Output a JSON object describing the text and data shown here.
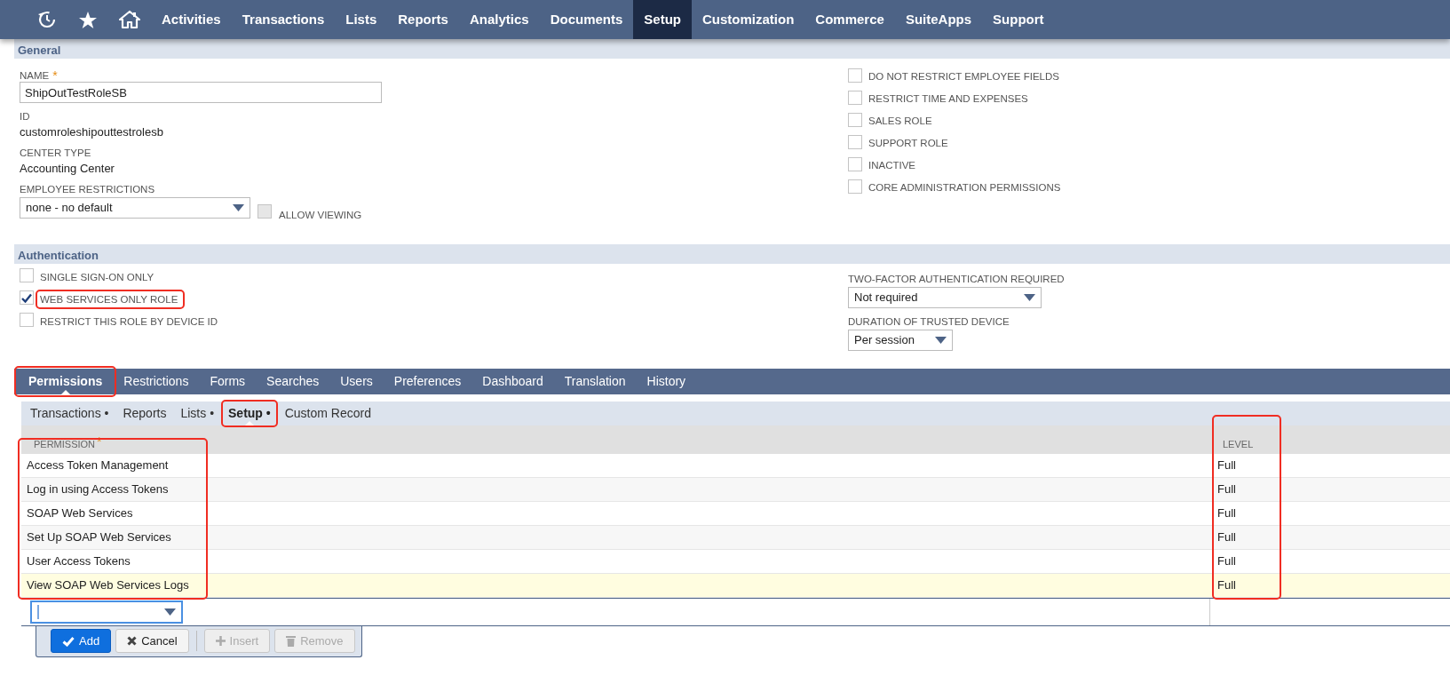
{
  "nav": {
    "items": [
      {
        "label": "Activities",
        "selected": false
      },
      {
        "label": "Transactions",
        "selected": false
      },
      {
        "label": "Lists",
        "selected": false
      },
      {
        "label": "Reports",
        "selected": false
      },
      {
        "label": "Analytics",
        "selected": false
      },
      {
        "label": "Documents",
        "selected": false
      },
      {
        "label": "Setup",
        "selected": true
      },
      {
        "label": "Customization",
        "selected": false
      },
      {
        "label": "Commerce",
        "selected": false
      },
      {
        "label": "SuiteApps",
        "selected": false
      },
      {
        "label": "Support",
        "selected": false
      }
    ]
  },
  "general": {
    "title": "General",
    "fields": [
      {
        "kind": "text",
        "label": "NAME",
        "required_mark": "*",
        "value": "ShipOutTestRoleSB"
      },
      {
        "kind": "static",
        "label": "ID",
        "value": "customroleshipouttestrolesb"
      },
      {
        "kind": "static",
        "label": "CENTER TYPE",
        "value": "Accounting Center"
      },
      {
        "kind": "select",
        "label": "EMPLOYEE RESTRICTIONS",
        "value": "none - no default"
      }
    ],
    "allow_viewing": {
      "label": "ALLOW VIEWING",
      "checked": false,
      "disabled": true
    },
    "checkboxes": [
      {
        "label": "DO NOT RESTRICT EMPLOYEE FIELDS",
        "checked": false
      },
      {
        "label": "RESTRICT TIME AND EXPENSES",
        "checked": false
      },
      {
        "label": "SALES ROLE",
        "checked": false
      },
      {
        "label": "SUPPORT ROLE",
        "checked": false
      },
      {
        "label": "INACTIVE",
        "checked": false
      },
      {
        "label": "CORE ADMINISTRATION PERMISSIONS",
        "checked": false
      }
    ]
  },
  "authentication": {
    "title": "Authentication",
    "checkboxes": [
      {
        "label": "SINGLE SIGN-ON ONLY",
        "checked": false,
        "highlighted": false
      },
      {
        "label": "WEB SERVICES ONLY ROLE",
        "checked": true,
        "highlighted": true
      },
      {
        "label": "RESTRICT THIS ROLE BY DEVICE ID",
        "checked": false,
        "highlighted": false
      }
    ],
    "fields": [
      {
        "kind": "select",
        "label": "TWO-FACTOR AUTHENTICATION REQUIRED",
        "value": "Not required"
      },
      {
        "kind": "select",
        "label": "DURATION OF TRUSTED DEVICE",
        "value": "Per session"
      }
    ]
  },
  "tabs": [
    {
      "label": "Permissions",
      "selected": true,
      "highlighted": true
    },
    {
      "label": "Restrictions",
      "selected": false,
      "highlighted": false
    },
    {
      "label": "Forms",
      "selected": false,
      "highlighted": false
    },
    {
      "label": "Searches",
      "selected": false,
      "highlighted": false
    },
    {
      "label": "Users",
      "selected": false,
      "highlighted": false
    },
    {
      "label": "Preferences",
      "selected": false,
      "highlighted": false
    },
    {
      "label": "Dashboard",
      "selected": false,
      "highlighted": false
    },
    {
      "label": "Translation",
      "selected": false,
      "highlighted": false
    },
    {
      "label": "History",
      "selected": false,
      "highlighted": false
    }
  ],
  "subtabs": [
    {
      "label": "Transactions •",
      "selected": false,
      "highlighted": false
    },
    {
      "label": "Reports",
      "selected": false,
      "highlighted": false
    },
    {
      "label": "Lists •",
      "selected": false,
      "highlighted": false
    },
    {
      "label": "Setup •",
      "selected": true,
      "highlighted": true
    },
    {
      "label": "Custom Record",
      "selected": false,
      "highlighted": false
    }
  ],
  "table": {
    "columns": [
      {
        "label": "PERMISSION",
        "required_mark": "*",
        "highlighted": true
      },
      {
        "label": "LEVEL",
        "highlighted": true
      }
    ],
    "rows": [
      {
        "cells": [
          "Access Token Management",
          "Full"
        ],
        "selected": false
      },
      {
        "cells": [
          "Log in using Access Tokens",
          "Full"
        ],
        "selected": false
      },
      {
        "cells": [
          "SOAP Web Services",
          "Full"
        ],
        "selected": false
      },
      {
        "cells": [
          "Set Up SOAP Web Services",
          "Full"
        ],
        "selected": false
      },
      {
        "cells": [
          "User Access Tokens",
          "Full"
        ],
        "selected": false
      },
      {
        "cells": [
          "View SOAP Web Services Logs",
          "Full"
        ],
        "selected": true
      }
    ]
  },
  "buttons": [
    {
      "label": "Add",
      "kind": "add",
      "disabled": false
    },
    {
      "label": "Cancel",
      "kind": "cancel",
      "disabled": false
    },
    {
      "label": "Insert",
      "kind": "insert",
      "disabled": true
    },
    {
      "label": "Remove",
      "kind": "remove",
      "disabled": true
    }
  ]
}
